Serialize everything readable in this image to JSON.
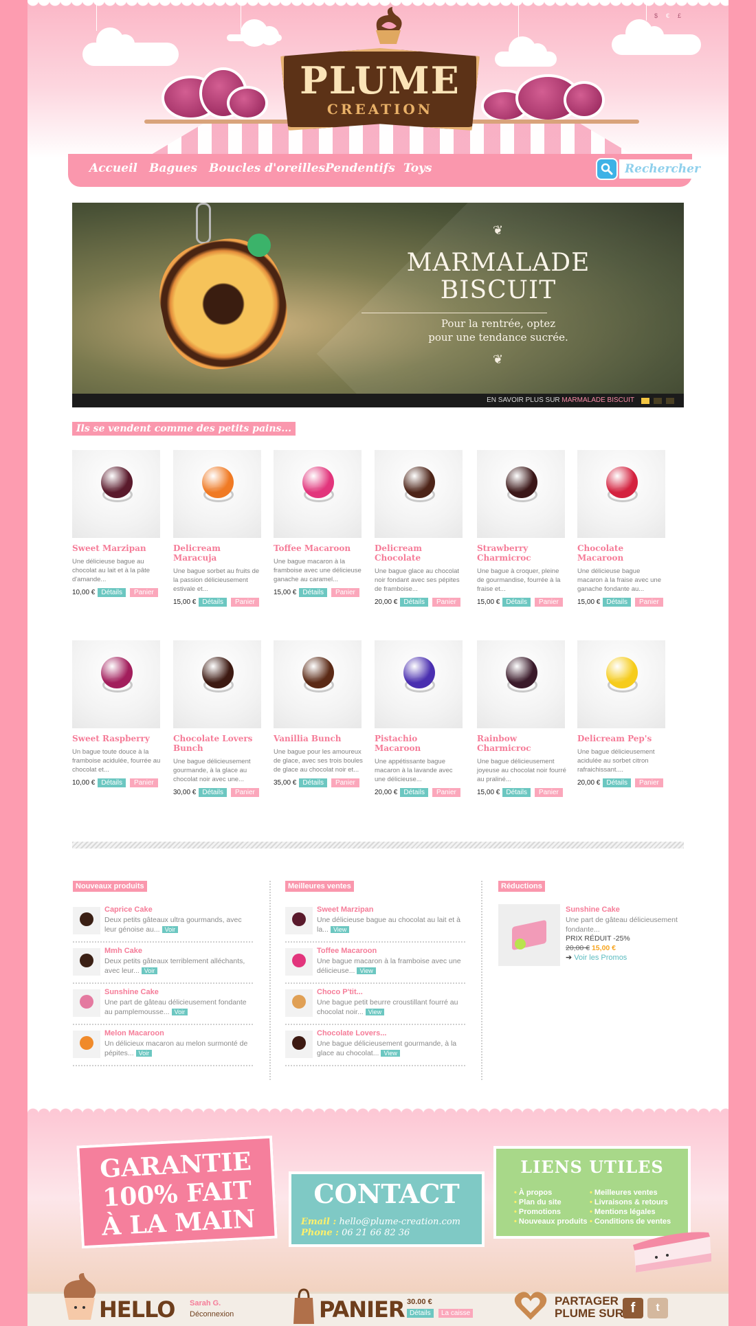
{
  "header": {
    "lang": [
      "$",
      "€",
      "£"
    ],
    "logo_top": "PLUME",
    "logo_bottom": "CREATION"
  },
  "nav": {
    "items": [
      "Accueil",
      "Bagues",
      "Boucles d'oreilles",
      "Pendentifs",
      "Toys"
    ],
    "search_placeholder": "Rechercher"
  },
  "hero": {
    "title_line1": "MARMALADE",
    "title_line2": "BISCUIT",
    "sub_line1": "Pour la rentrée, optez",
    "sub_line2": "pour une tendance sucrée.",
    "more_prefix": "EN SAVOIR PLUS SUR",
    "more_link": "MARMALADE BISCUIT"
  },
  "bestsellers": {
    "title": "Ils se vendent comme des petits pains...",
    "details_label": "Détails",
    "cart_label": "Panier",
    "row1": [
      {
        "name": "Sweet Marzipan",
        "desc": "Une délicieuse bague au chocolat au lait et à la pâte d'amande...",
        "price": "10,00 €",
        "color": "#5a1a2c"
      },
      {
        "name": "Delicream Maracuja",
        "desc": "Une bague sorbet au fruits de la passion délicieusement estivale et...",
        "price": "15,00 €",
        "color": "#f07a24"
      },
      {
        "name": "Toffee Macaroon",
        "desc": "Une bague macaron à la framboise avec une délicieuse ganache au caramel...",
        "price": "15,00 €",
        "color": "#e2357c"
      },
      {
        "name": "Delicream Chocolate",
        "desc": "Une bague glace au chocolat noir fondant avec ses pépites de framboise...",
        "price": "20,00 €",
        "color": "#4d2418"
      },
      {
        "name": "Strawberry Charmicroc",
        "desc": "Une bague à croquer, pleine de gourmandise, fourrée à la fraise et...",
        "price": "15,00 €",
        "color": "#3b1718"
      },
      {
        "name": "Chocolate Macaroon",
        "desc": "Une délicieuse bague macaron à la fraise avec une ganache fondante au...",
        "price": "15,00 €",
        "color": "#d4223f"
      }
    ],
    "row2": [
      {
        "name": "Sweet Raspberry",
        "desc": "Un bague toute douce à la framboise acidulée, fourrée au chocolat et...",
        "price": "10,00 €",
        "color": "#a21e5c"
      },
      {
        "name": "Chocolate Lovers Bunch",
        "desc": "Une bague délicieusement gourmande, à la glace au chocolat noir avec une...",
        "price": "30,00 €",
        "color": "#3d1a12"
      },
      {
        "name": "Vanillia Bunch",
        "desc": "Une bague pour les amoureux de glace, avec ses trois boules de glace au chocolat noir et...",
        "price": "35,00 €",
        "color": "#5b2a16"
      },
      {
        "name": "Pistachio Macaroon",
        "desc": "Une appétissante bague macaron à la lavande avec une délicieuse...",
        "price": "20,00 €",
        "color": "#4a2fb0"
      },
      {
        "name": "Rainbow Charmicroc",
        "desc": "Une bague délicieusement joyeuse au chocolat noir fourré au praliné...",
        "price": "15,00 €",
        "color": "#3a1a2a"
      },
      {
        "name": "Delicream Pep's",
        "desc": "Une bague délicieusement acidulée au sorbet citron rafraichissant....",
        "price": "20,00 €",
        "color": "#f6cc1b"
      }
    ]
  },
  "new_products": {
    "title": "Nouveaux produits",
    "view_label": "Voir",
    "items": [
      {
        "name": "Caprice Cake",
        "desc": "Deux petits gâteaux ultra gourmands, avec leur génoise au...",
        "color": "#3a1f14"
      },
      {
        "name": "Mmh Cake",
        "desc": "Deux petits gâteaux terriblement alléchants, avec leur...",
        "color": "#3a1f14"
      },
      {
        "name": "Sunshine Cake",
        "desc": "Une part de gâteau délicieusement fondante au pamplemousse...",
        "color": "#e47aa0"
      },
      {
        "name": "Melon Macaroon",
        "desc": "Un délicieux macaron au melon surmonté de pépites...",
        "color": "#f08a2a"
      }
    ]
  },
  "top_sales": {
    "title": "Meilleures ventes",
    "view_label": "View",
    "items": [
      {
        "name": "Sweet Marzipan",
        "desc": "Une délicieuse bague au chocolat au lait et à la...",
        "color": "#5a1a2c"
      },
      {
        "name": "Toffee Macaroon",
        "desc": "Une bague macaron à la framboise avec une délicieuse...",
        "color": "#e2357c"
      },
      {
        "name": "Choco P'tit...",
        "desc": "Une bague petit beurre croustillant fourré au chocolat noir...",
        "color": "#e0a055"
      },
      {
        "name": "Chocolate Lovers...",
        "desc": "Une bague délicieusement gourmande, à la glace au chocolat...",
        "color": "#3d1a12"
      }
    ]
  },
  "promos": {
    "title": "Réductions",
    "name": "Sunshine Cake",
    "desc": "Une part de gâteau délicieusement fondante...",
    "reduced_label": "PRIX RÉDUIT -25%",
    "old_price": "20,00 €",
    "new_price": "15,00 €",
    "link": "Voir les Promos"
  },
  "footer": {
    "garantie": [
      "GARANTIE",
      "100% FAIT",
      "À LA MAIN"
    ],
    "contact_title": "CONTACT",
    "email_label": "Email :",
    "email": "hello@plume-creation.com",
    "phone_label": "Phone :",
    "phone": "06 21 66 82 36",
    "links_title": "LIENS UTILES",
    "links_left": [
      "À propos",
      "Plan du site",
      "Promotions",
      "Nouveaux produits"
    ],
    "links_right": [
      "Meilleures ventes",
      "Livraisons & retours",
      "Mentions légales",
      "Conditions de ventes"
    ]
  },
  "bottom": {
    "hello": "HELLO",
    "user": "Sarah G.",
    "logout": "Déconnexion",
    "cart": "PANIER",
    "cart_total": "30.00 €",
    "cart_details": "Détails",
    "checkout": "La caisse",
    "share_line1": "PARTAGER",
    "share_line2": "PLUME SUR"
  },
  "colors": {
    "pink": "#fa97ad",
    "teal": "#6cc7c1",
    "brown": "#6e3e1c",
    "green": "#a8d889"
  }
}
